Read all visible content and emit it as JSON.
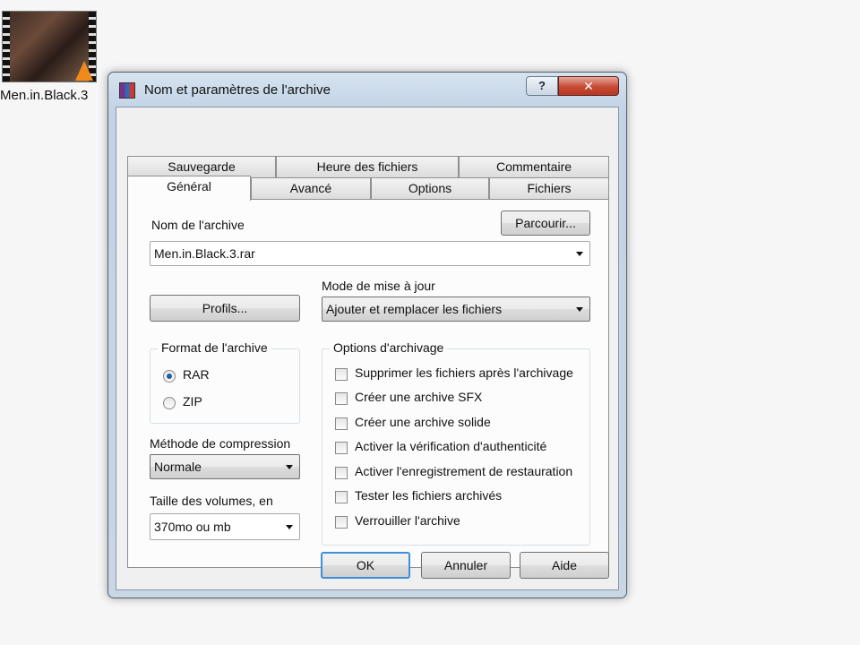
{
  "desktop": {
    "file_label": "Men.in.Black.3"
  },
  "window": {
    "title": "Nom et paramètres de l'archive",
    "help_glyph": "?",
    "close_glyph": "✕"
  },
  "tabs": {
    "row_top": [
      "Sauvegarde",
      "Heure des fichiers",
      "Commentaire"
    ],
    "row_bottom": [
      "Général",
      "Avancé",
      "Options",
      "Fichiers"
    ],
    "active": "Général"
  },
  "general": {
    "archive_name_label": "Nom de l'archive",
    "browse_button": "Parcourir...",
    "archive_name_value": "Men.in.Black.3.rar",
    "profiles_button": "Profils...",
    "update_mode_label": "Mode de mise à jour",
    "update_mode_value": "Ajouter et remplacer les fichiers",
    "format_group_title": "Format de l'archive",
    "format_options": [
      {
        "label": "RAR",
        "selected": true
      },
      {
        "label": "ZIP",
        "selected": false
      }
    ],
    "compression_label": "Méthode de compression",
    "compression_value": "Normale",
    "volume_size_label": "Taille des volumes, en",
    "volume_size_value": "370mo ou mb",
    "archiving_options_title": "Options d'archivage",
    "archiving_options": [
      {
        "label": "Supprimer les fichiers après l'archivage",
        "checked": false
      },
      {
        "label": "Créer une archive SFX",
        "checked": false
      },
      {
        "label": "Créer une archive solide",
        "checked": false
      },
      {
        "label": "Activer la vérification d'authenticité",
        "checked": false
      },
      {
        "label": "Activer l'enregistrement de restauration",
        "checked": false
      },
      {
        "label": "Tester les fichiers archivés",
        "checked": false
      },
      {
        "label": "Verrouiller l'archive",
        "checked": false
      }
    ]
  },
  "footer": {
    "ok": "OK",
    "cancel": "Annuler",
    "help": "Aide"
  }
}
